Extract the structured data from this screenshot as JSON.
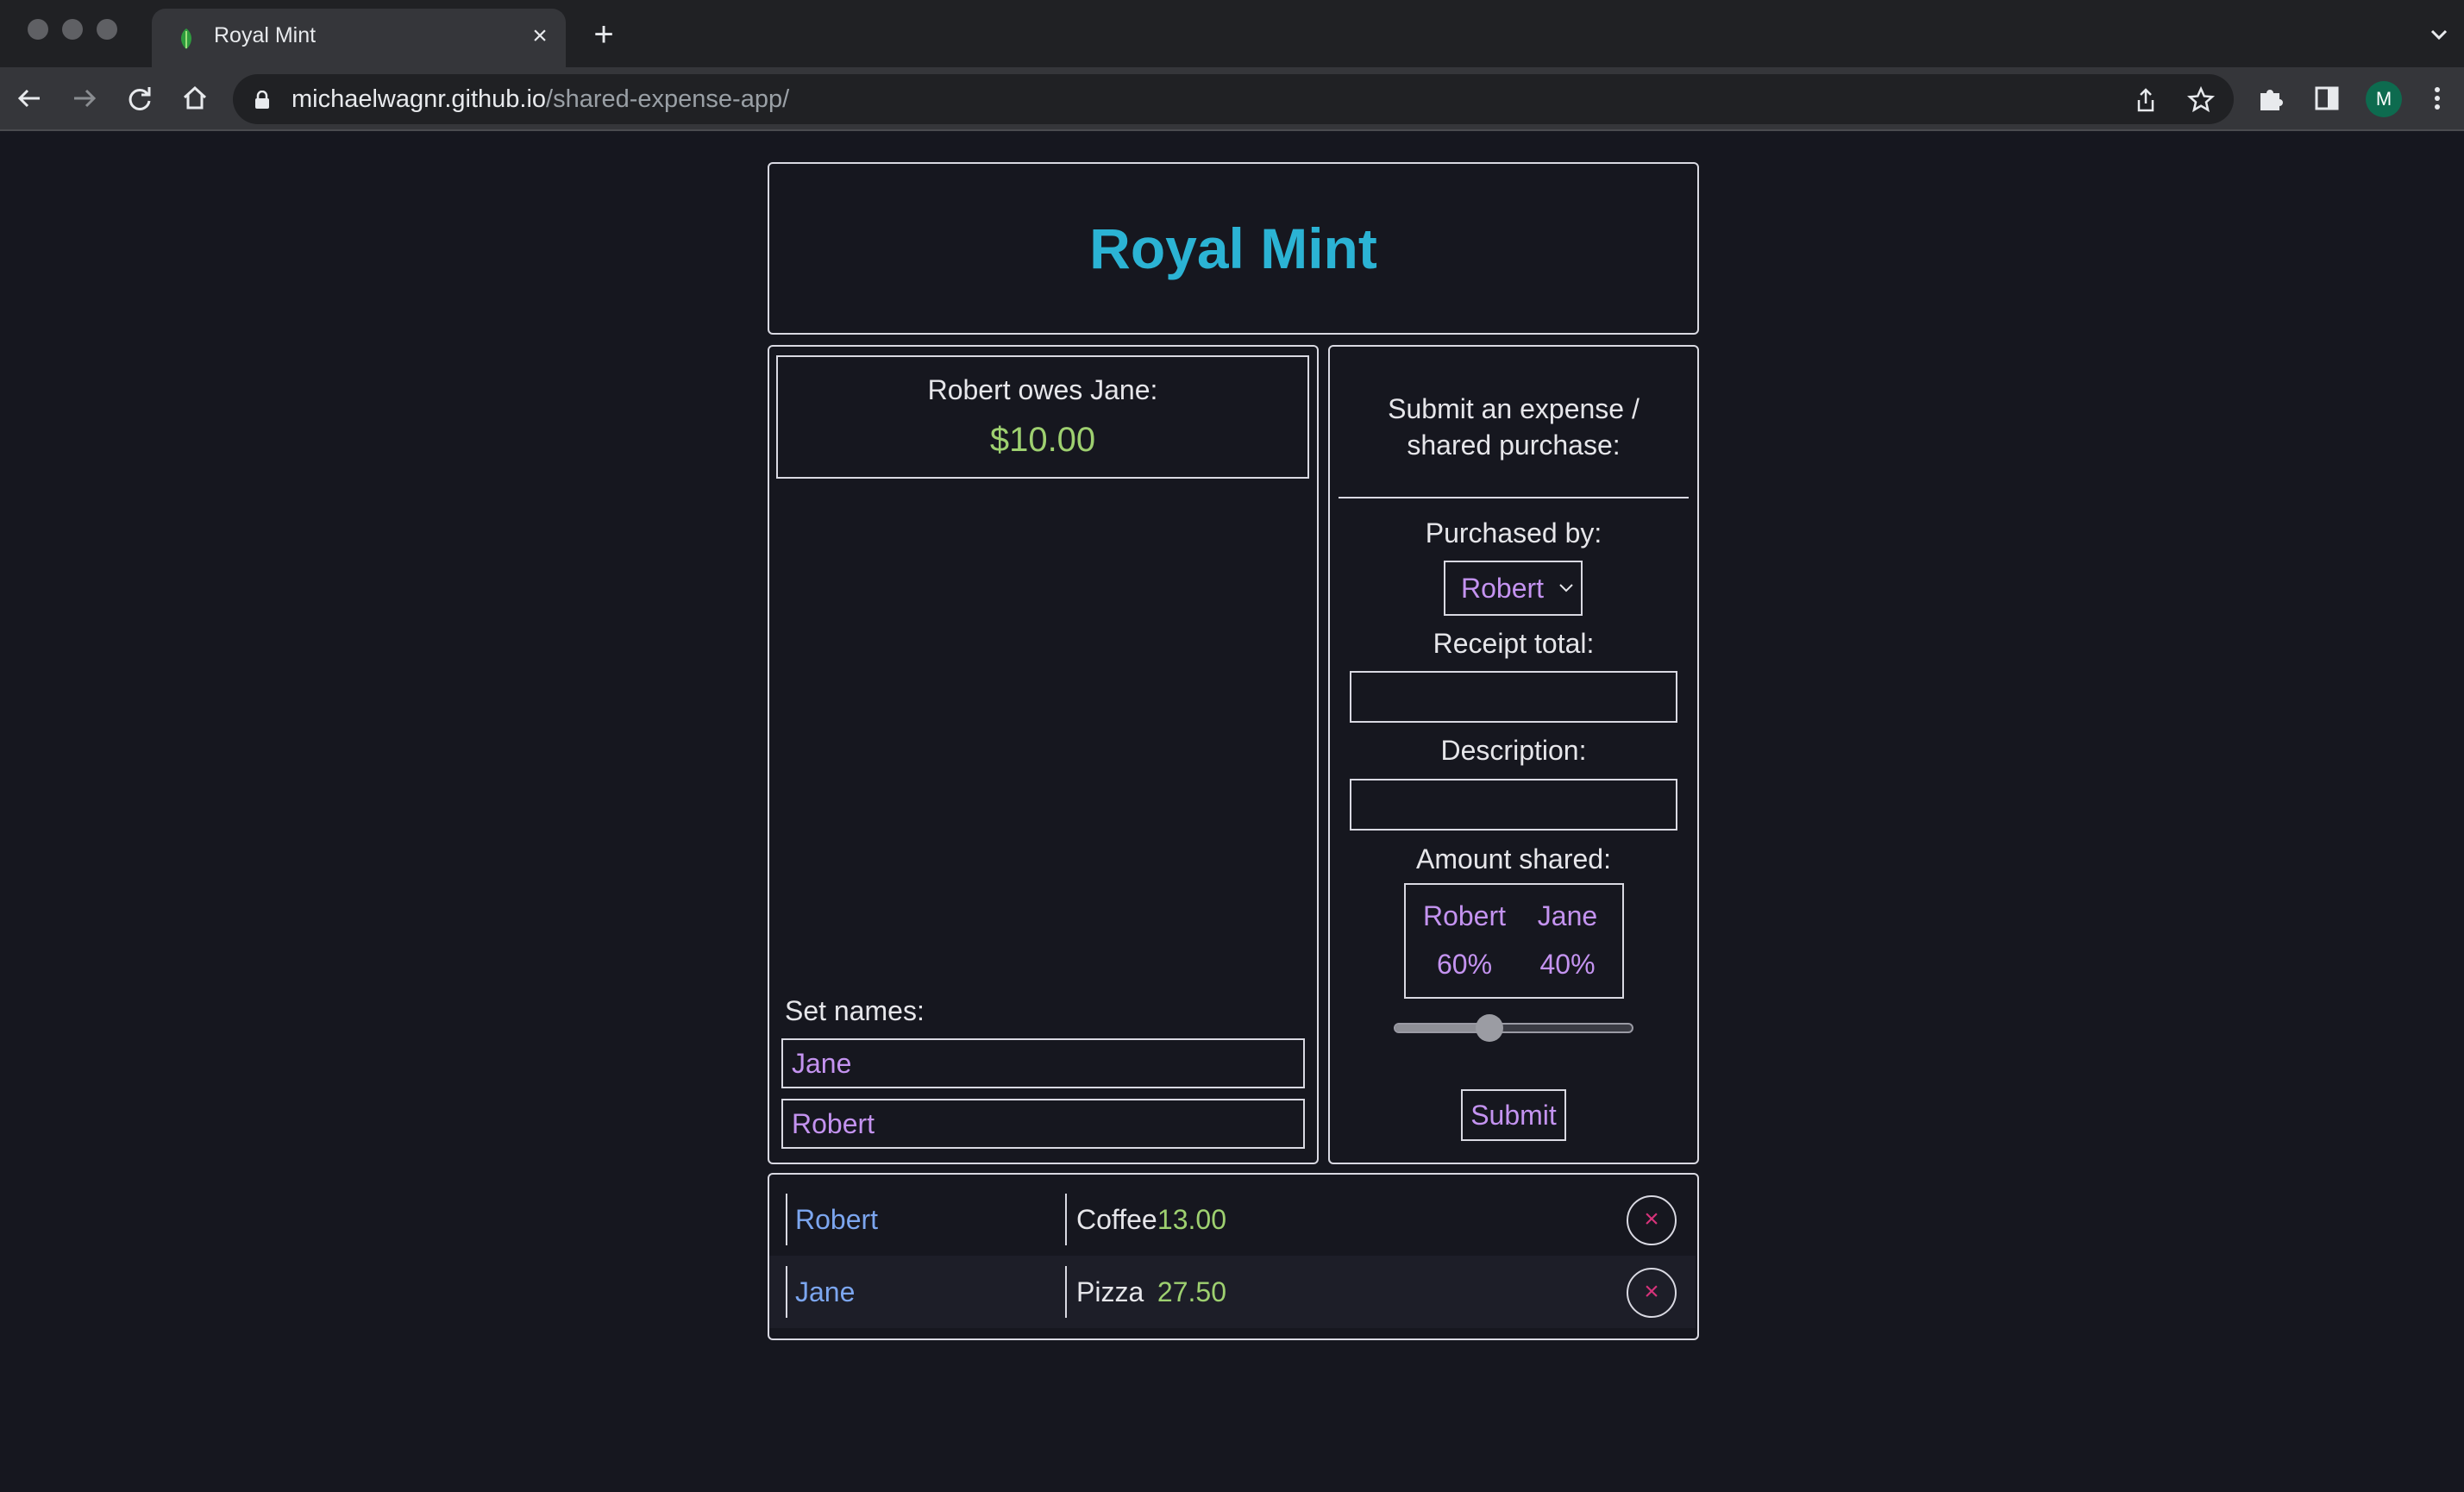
{
  "browser": {
    "tab_title": "Royal Mint",
    "tab_close": "×",
    "new_tab": "+",
    "url_host": "michaelwagnr.github.io",
    "url_path": "/shared-expense-app/",
    "profile_initial": "M"
  },
  "app": {
    "title": "Royal Mint",
    "accent_color": "#2bb3d4"
  },
  "balance": {
    "label": "Robert owes Jane:",
    "amount": "$10.00"
  },
  "names": {
    "label": "Set names:",
    "name_1": "Jane",
    "name_2": "Robert"
  },
  "form": {
    "heading_line1": "Submit an expense /",
    "heading_line2": "shared purchase:",
    "purchased_by_label": "Purchased by:",
    "purchased_by_value": "Robert",
    "receipt_label": "Receipt total:",
    "receipt_value": "",
    "description_label": "Description:",
    "description_value": "",
    "amount_shared_label": "Amount shared:",
    "share": [
      {
        "name": "Robert",
        "percent": "60%"
      },
      {
        "name": "Jane",
        "percent": "40%"
      }
    ],
    "slider_fraction": 0.4,
    "submit_label": "Submit"
  },
  "expenses": [
    {
      "payer": "Robert",
      "amount": "13.00",
      "description": "Coffee",
      "delete": "×"
    },
    {
      "payer": "Jane",
      "amount": "27.50",
      "description": "Pizza",
      "delete": "×"
    }
  ]
}
